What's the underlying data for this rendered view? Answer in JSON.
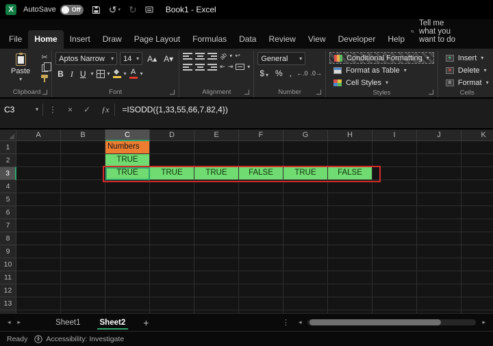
{
  "colors": {
    "excel_green": "#107C41",
    "accent_green": "#2EA56B",
    "fill_yellow": "#F2C84B",
    "font_red": "#E23B2E",
    "cell_green": "#70DB70",
    "cell_orange": "#ED7D31",
    "annotation_red": "#D42A2A"
  },
  "icons": {
    "app": "X",
    "dropdown": "▾",
    "undo": "↺",
    "redo": "↻",
    "cut": "✂",
    "dots": "⋮",
    "cancel": "×",
    "enter": "✓",
    "fx": "ƒx",
    "sum": "Σ",
    "comma": ",",
    "percent": "%",
    "currency": "$",
    "increase_decimal": "←.0",
    "decrease_decimal": ".0→",
    "indent_decrease": "⇤",
    "indent_increase": "⇥",
    "wrap": "↩",
    "orientation": "ab",
    "increase_font": "A▴",
    "decrease_font": "A▾",
    "nav_left": "◂",
    "nav_right": "▸",
    "add_sheet": "+",
    "plus": "+",
    "cross": "×",
    "format_glyph": "≡"
  },
  "titlebar": {
    "autosave_label": "AutoSave",
    "autosave_state": "Off",
    "title": "Book1 - Excel"
  },
  "menubar": {
    "tabs": [
      {
        "label": "File"
      },
      {
        "label": "Home"
      },
      {
        "label": "Insert"
      },
      {
        "label": "Draw"
      },
      {
        "label": "Page Layout"
      },
      {
        "label": "Formulas"
      },
      {
        "label": "Data"
      },
      {
        "label": "Review"
      },
      {
        "label": "View"
      },
      {
        "label": "Developer"
      },
      {
        "label": "Help"
      }
    ],
    "search_text": "Tell me what you want to do"
  },
  "ribbon": {
    "clipboard": {
      "group_label": "Clipboard",
      "paste_label": "Paste"
    },
    "font": {
      "group_label": "Font",
      "font_name": "Aptos Narrow",
      "font_size": "14",
      "bold": "B",
      "italic": "I",
      "underline": "U"
    },
    "alignment": {
      "group_label": "Alignment"
    },
    "number": {
      "group_label": "Number",
      "format": "General"
    },
    "styles": {
      "group_label": "Styles",
      "conditional_formatting": "Conditional Formatting",
      "format_as_table": "Format as Table",
      "cell_styles": "Cell Styles"
    },
    "cells": {
      "group_label": "Cells",
      "insert": "Insert",
      "delete": "Delete",
      "format": "Format"
    }
  },
  "formula_bar": {
    "name_box": "C3",
    "formula": "=ISODD({1,33,55,66,7.82,4})"
  },
  "grid": {
    "columns": [
      "A",
      "B",
      "C",
      "D",
      "E",
      "F",
      "G",
      "H",
      "I",
      "J",
      "K"
    ],
    "row_count": 14,
    "active_cell": "C3",
    "selected_column": "C",
    "selected_row": 3,
    "cells": [
      {
        "ref": "C1",
        "text": "Numbers",
        "bg": "#ED7D31",
        "fg": "#141414",
        "align": "left"
      },
      {
        "ref": "C2",
        "text": "TRUE",
        "bg": "#70DB70",
        "fg": "#10340f",
        "align": "center"
      },
      {
        "ref": "C3",
        "text": "TRUE",
        "bg": "#70DB70",
        "fg": "#10340f",
        "align": "center"
      },
      {
        "ref": "D3",
        "text": "TRUE",
        "bg": "#70DB70",
        "fg": "#10340f",
        "align": "center"
      },
      {
        "ref": "E3",
        "text": "TRUE",
        "bg": "#70DB70",
        "fg": "#10340f",
        "align": "center"
      },
      {
        "ref": "F3",
        "text": "FALSE",
        "bg": "#70DB70",
        "fg": "#10340f",
        "align": "center"
      },
      {
        "ref": "G3",
        "text": "TRUE",
        "bg": "#70DB70",
        "fg": "#10340f",
        "align": "center"
      },
      {
        "ref": "H3",
        "text": "FALSE",
        "bg": "#70DB70",
        "fg": "#10340f",
        "align": "center"
      }
    ],
    "annotation_color": "#D42A2A"
  },
  "sheet_tabs": {
    "tabs": [
      {
        "label": "Sheet1"
      },
      {
        "label": "Sheet2"
      }
    ],
    "active": "Sheet2"
  },
  "status_bar": {
    "mode": "Ready",
    "accessibility": "Accessibility: Investigate"
  }
}
